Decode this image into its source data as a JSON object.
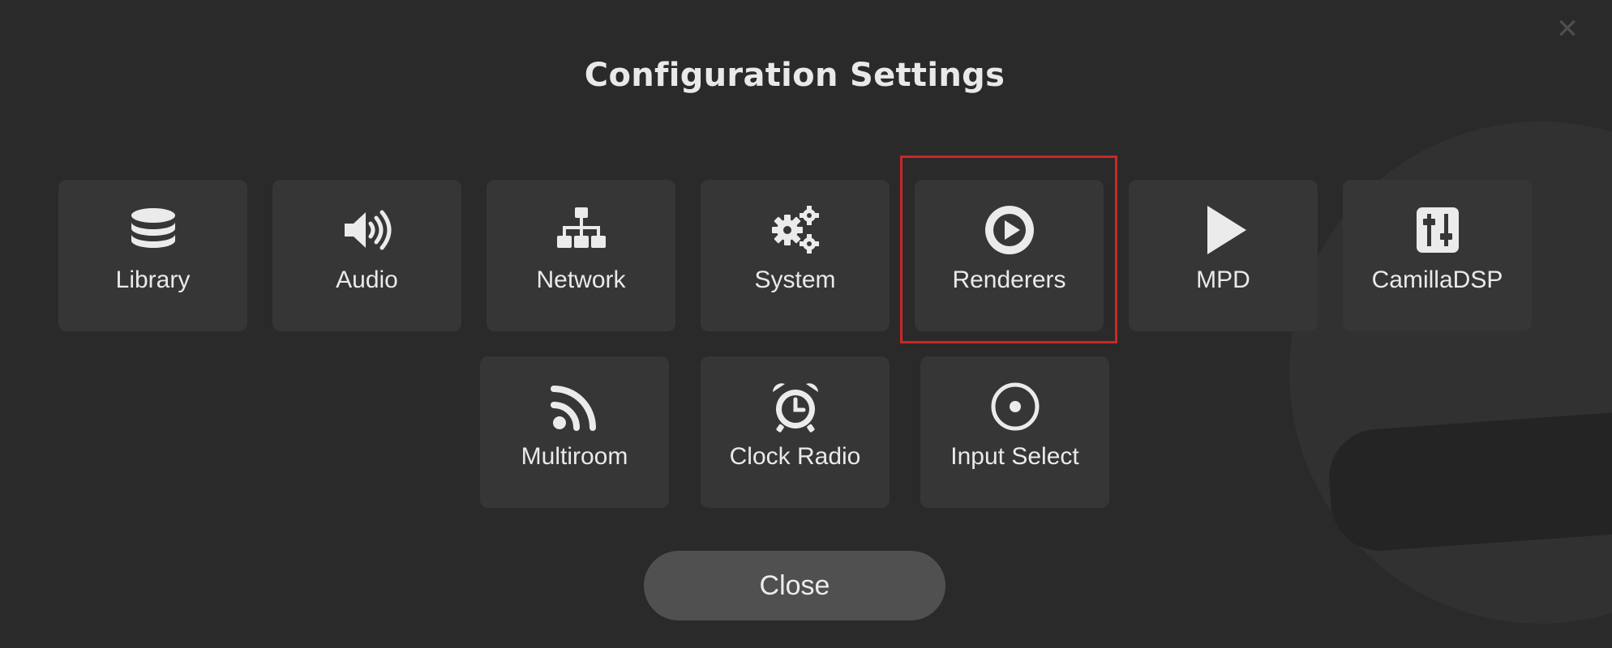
{
  "dialog": {
    "title": "Configuration Settings",
    "dismiss_glyph": "✕",
    "close_label": "Close"
  },
  "tiles": [
    {
      "label": "Library",
      "icon": "database-icon",
      "selected": false
    },
    {
      "label": "Audio",
      "icon": "speaker-icon",
      "selected": false
    },
    {
      "label": "Network",
      "icon": "network-icon",
      "selected": false
    },
    {
      "label": "System",
      "icon": "gears-icon",
      "selected": false
    },
    {
      "label": "Renderers",
      "icon": "play-circle-icon",
      "selected": true
    },
    {
      "label": "MPD",
      "icon": "play-icon",
      "selected": false
    },
    {
      "label": "CamillaDSP",
      "icon": "sliders-icon",
      "selected": false
    },
    {
      "label": "Multiroom",
      "icon": "rss-icon",
      "selected": false
    },
    {
      "label": "Clock Radio",
      "icon": "alarm-clock-icon",
      "selected": false
    },
    {
      "label": "Input Select",
      "icon": "radio-button-icon",
      "selected": false
    }
  ],
  "colors": {
    "background": "#2a2a2a",
    "tile": "#363636",
    "text": "#eaeaea",
    "highlight_border": "#cc2626",
    "close_button": "#505050"
  }
}
